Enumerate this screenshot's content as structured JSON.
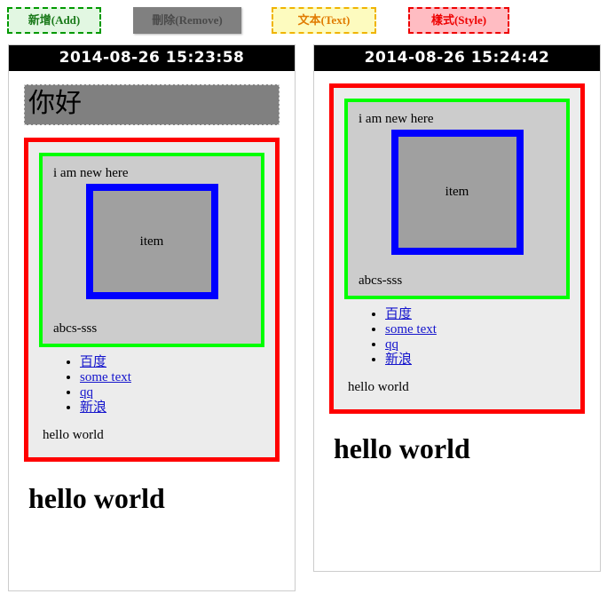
{
  "toolbar": {
    "buttons": [
      {
        "label": "新增(Add)",
        "name": "add-button",
        "color": "#1a7a1a"
      },
      {
        "label": "刪除(Remove)",
        "name": "remove-button",
        "color": "#4a4a4a"
      },
      {
        "label": "文本(Text)",
        "name": "text-button",
        "color": "#e07b00"
      },
      {
        "label": "樣式(Style)",
        "name": "style-button",
        "color": "#ee0000"
      }
    ]
  },
  "panels": [
    {
      "timestamp": "2014-08-26 15:23:58",
      "greeting": "你好",
      "has_greeting": true,
      "green_label": "i am new here",
      "item_label": "item",
      "green_footer": "abcs-sss",
      "links": [
        "百度",
        "some text",
        "qq",
        "新浪"
      ],
      "inner_paragraph": "hello world",
      "heading": "hello world"
    },
    {
      "timestamp": "2014-08-26 15:24:42",
      "greeting": "",
      "has_greeting": false,
      "green_label": "i am new here",
      "item_label": "item",
      "green_footer": "abcs-sss",
      "links": [
        "百度",
        "some text",
        "qq",
        "新浪"
      ],
      "inner_paragraph": "hello world",
      "heading": "hello world"
    }
  ],
  "colors": {
    "red_border": "#ff0000",
    "green_border": "#00ff00",
    "blue_border": "#0000ff",
    "gray_fill": "#cccccc",
    "dark_gray_fill": "#a0a0a0",
    "greeting_fill": "#808080",
    "link": "#1414cc",
    "header_bg": "#000000"
  }
}
